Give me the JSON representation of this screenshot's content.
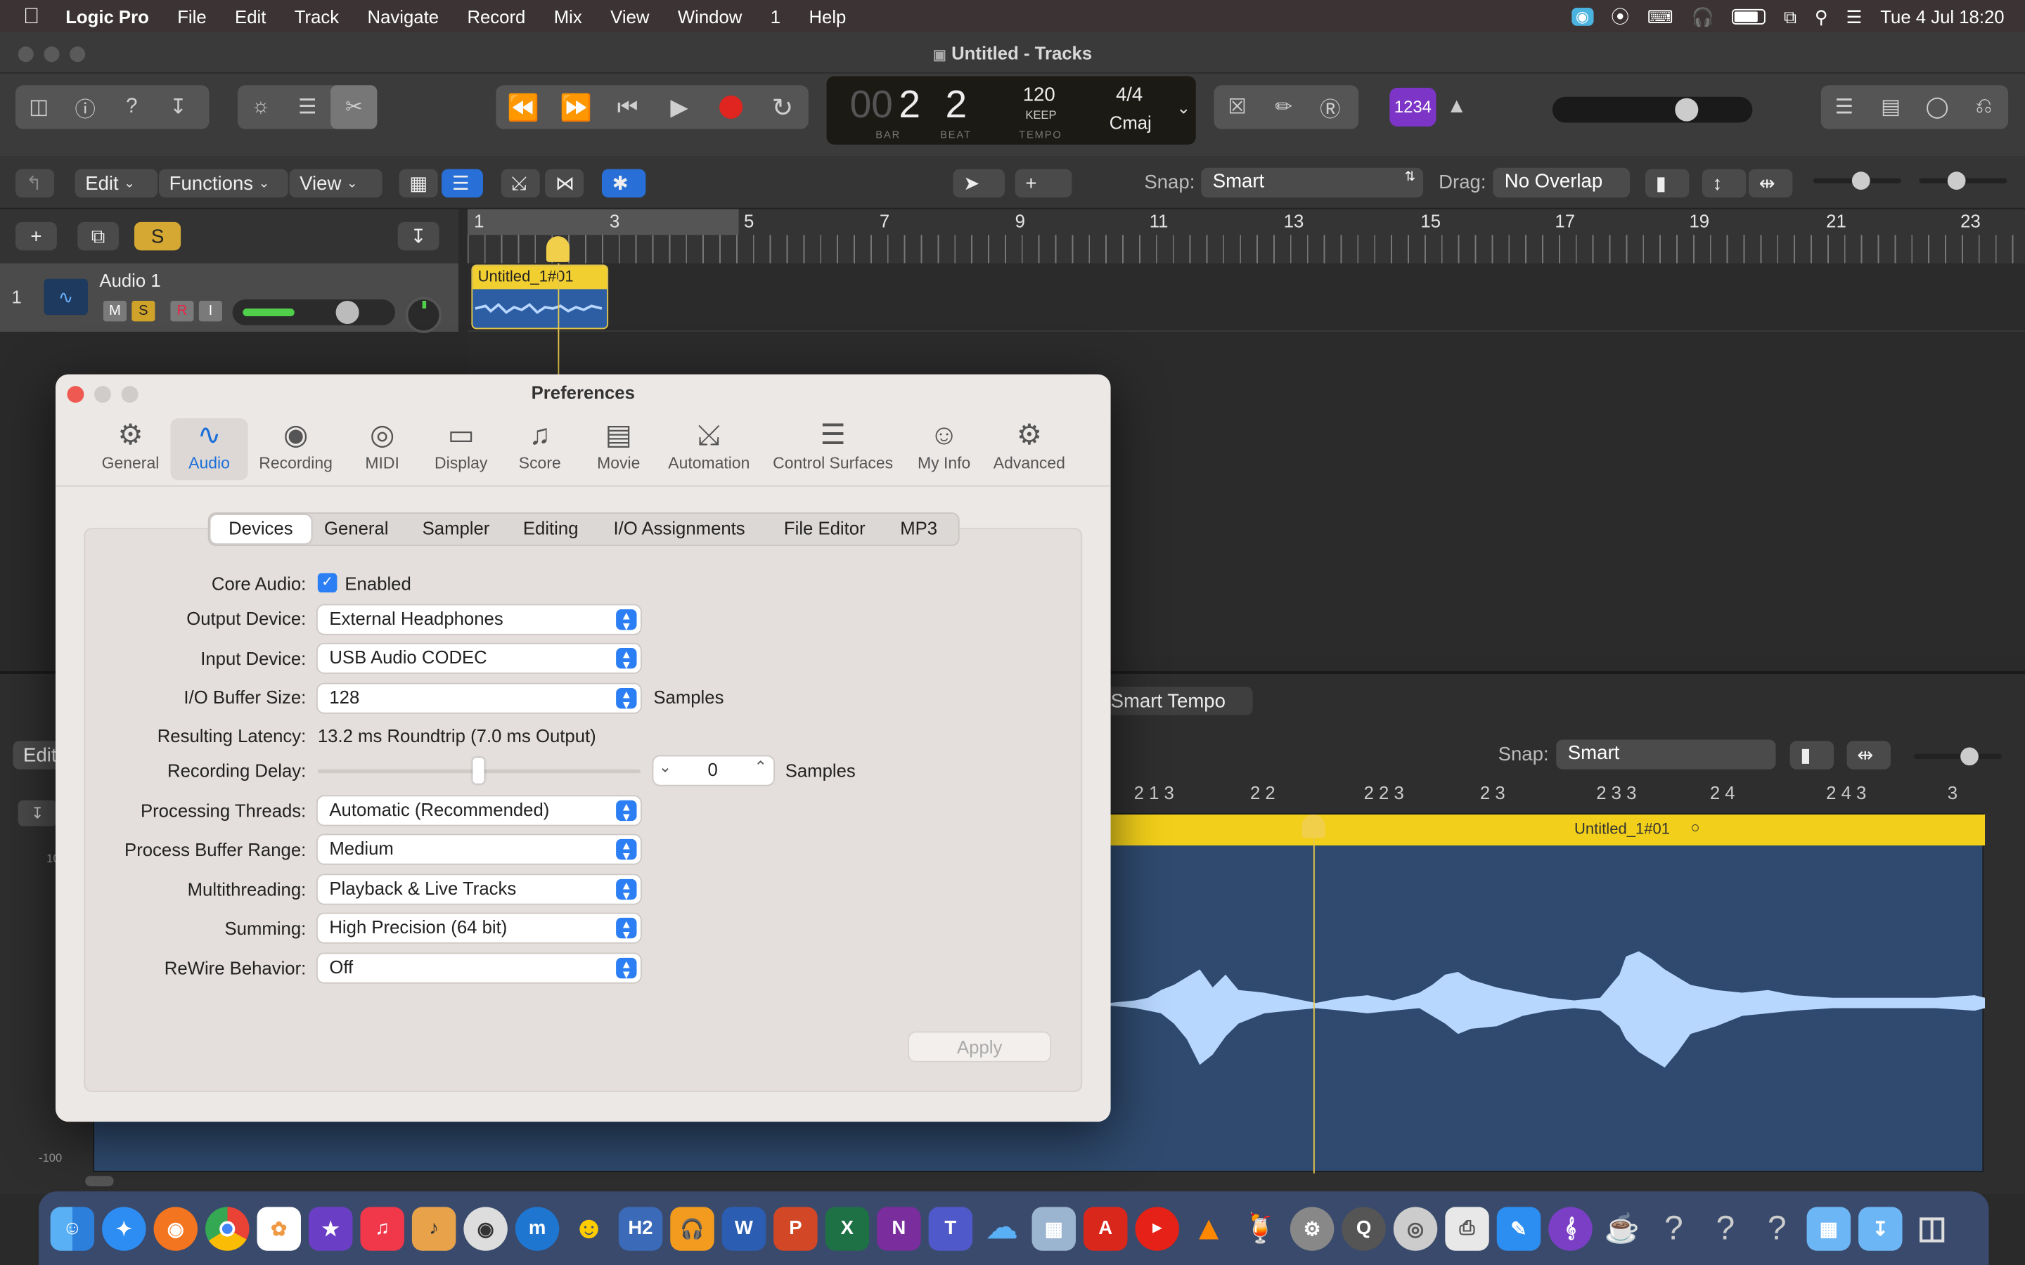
{
  "menubar": {
    "app": "Logic Pro",
    "items": [
      "File",
      "Edit",
      "Track",
      "Navigate",
      "Record",
      "Mix",
      "View",
      "Window",
      "1",
      "Help"
    ],
    "clock": "Tue 4 Jul  18:20"
  },
  "window": {
    "title": "Untitled - Tracks"
  },
  "lcd": {
    "bar_dim": "00",
    "bar": "2",
    "beat": "2",
    "bar_label": "BAR",
    "beat_label": "BEAT",
    "tempo": "120",
    "tempo_keep": "KEEP",
    "tempo_label": "TEMPO",
    "sig": "4/4",
    "key": "Cmaj",
    "badge": "1234"
  },
  "trackbar": {
    "edit": "Edit",
    "functions": "Functions",
    "view": "View",
    "snap_label": "Snap:",
    "snap": "Smart",
    "drag_label": "Drag:",
    "drag": "No Overlap"
  },
  "ruler": {
    "marks": [
      "1",
      "3",
      "5",
      "7",
      "9",
      "11",
      "13",
      "15",
      "17",
      "19",
      "21",
      "23"
    ]
  },
  "track": {
    "number": "1",
    "name": "Audio 1",
    "m": "M",
    "s": "S",
    "r": "R",
    "i": "I",
    "solo_btn": "S",
    "region": "Untitled_1#01"
  },
  "editor": {
    "smart_tempo": "Smart Tempo",
    "edit": "Edit",
    "snap_label": "Snap:",
    "snap": "Smart",
    "ruler": [
      "2 1 3",
      "2 2",
      "2 2 3",
      "2 3",
      "2 3 3",
      "2 4",
      "2 4 3",
      "3"
    ],
    "region": "Untitled_1#01",
    "scale_top": "10",
    "scale_bottom": "-100"
  },
  "prefs": {
    "title": "Preferences",
    "tabs": [
      "General",
      "Audio",
      "Recording",
      "MIDI",
      "Display",
      "Score",
      "Movie",
      "Automation",
      "Control Surfaces",
      "My Info",
      "Advanced"
    ],
    "subtabs": [
      "Devices",
      "General",
      "Sampler",
      "Editing",
      "I/O Assignments",
      "File Editor",
      "MP3"
    ],
    "core_audio_label": "Core Audio:",
    "core_audio_value": "Enabled",
    "core_audio_checked": true,
    "output_label": "Output Device:",
    "output_value": "External Headphones",
    "input_label": "Input Device:",
    "input_value": "USB Audio CODEC",
    "buffer_label": "I/O Buffer Size:",
    "buffer_value": "128",
    "buffer_unit": "Samples",
    "latency_label": "Resulting Latency:",
    "latency_value": "13.2 ms Roundtrip (7.0 ms Output)",
    "delay_label": "Recording Delay:",
    "delay_value": "0",
    "delay_unit": "Samples",
    "threads_label": "Processing Threads:",
    "threads_value": "Automatic (Recommended)",
    "range_label": "Process Buffer Range:",
    "range_value": "Medium",
    "multi_label": "Multithreading:",
    "multi_value": "Playback & Live Tracks",
    "summing_label": "Summing:",
    "summing_value": "High Precision (64 bit)",
    "rewire_label": "ReWire Behavior:",
    "rewire_value": "Off",
    "apply": "Apply"
  },
  "dock": {
    "icons": [
      "finder-icon",
      "safari-icon",
      "firefox-icon",
      "chrome-icon",
      "photos-icon",
      "imovie-icon",
      "music-icon",
      "garageband-icon",
      "logic-icon",
      "musescore-icon",
      "linux-icon",
      "h2-icon",
      "audacity-icon",
      "word-icon",
      "powerpoint-icon",
      "excel-icon",
      "onenote-icon",
      "teams-icon",
      "onedrive-icon",
      "preview-icon",
      "acrobat-icon",
      "youtube-icon",
      "vlc-icon",
      "drinks-icon",
      "settings-icon",
      "quicktime-icon",
      "dvd-icon",
      "printer-icon",
      "pages-icon",
      "musictheory-icon",
      "coffee-icon",
      "unknown-icon",
      "unknown-icon",
      "unknown-icon",
      "folder-icon",
      "downloads-icon",
      "trash-icon"
    ]
  }
}
